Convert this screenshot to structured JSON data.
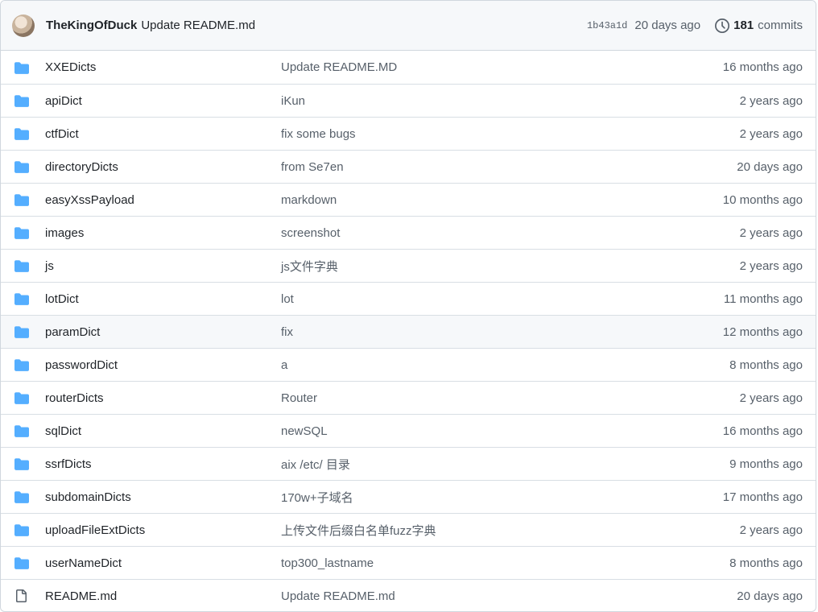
{
  "latest_commit": {
    "author": "TheKingOfDuck",
    "message": "Update README.md",
    "sha": "1b43a1d",
    "age": "20 days ago",
    "commit_count": "181",
    "commits_label": "commits"
  },
  "files": [
    {
      "type": "folder",
      "name": "XXEDicts",
      "message": "Update README.MD",
      "date": "16 months ago"
    },
    {
      "type": "folder",
      "name": "apiDict",
      "message": "iKun",
      "date": "2 years ago"
    },
    {
      "type": "folder",
      "name": "ctfDict",
      "message": "fix some bugs",
      "date": "2 years ago"
    },
    {
      "type": "folder",
      "name": "directoryDicts",
      "message": "from Se7en",
      "date": "20 days ago"
    },
    {
      "type": "folder",
      "name": "easyXssPayload",
      "message": "markdown",
      "date": "10 months ago"
    },
    {
      "type": "folder",
      "name": "images",
      "message": "screenshot",
      "date": "2 years ago"
    },
    {
      "type": "folder",
      "name": "js",
      "message": "js文件字典",
      "date": "2 years ago"
    },
    {
      "type": "folder",
      "name": "lotDict",
      "message": "lot",
      "date": "11 months ago"
    },
    {
      "type": "folder",
      "name": "paramDict",
      "message": "fix",
      "date": "12 months ago"
    },
    {
      "type": "folder",
      "name": "passwordDict",
      "message": "a",
      "date": "8 months ago"
    },
    {
      "type": "folder",
      "name": "routerDicts",
      "message": "Router",
      "date": "2 years ago"
    },
    {
      "type": "folder",
      "name": "sqlDict",
      "message": "newSQL",
      "date": "16 months ago"
    },
    {
      "type": "folder",
      "name": "ssrfDicts",
      "message": "aix /etc/ 目录",
      "date": "9 months ago"
    },
    {
      "type": "folder",
      "name": "subdomainDicts",
      "message": "170w+子域名",
      "date": "17 months ago"
    },
    {
      "type": "folder",
      "name": "uploadFileExtDicts",
      "message": "上传文件后缀白名单fuzz字典",
      "date": "2 years ago"
    },
    {
      "type": "folder",
      "name": "userNameDict",
      "message": "top300_lastname",
      "date": "8 months ago"
    },
    {
      "type": "file",
      "name": "README.md",
      "message": "Update README.md",
      "date": "20 days ago"
    }
  ],
  "colors": {
    "folder_icon": "#54aeff",
    "file_icon": "#57606a",
    "header_bg": "#f6f8fa",
    "border": "#d0d7de",
    "muted_text": "#57606a"
  },
  "icons": {
    "folder": "folder-icon",
    "file": "file-icon",
    "history": "history-icon",
    "avatar": "avatar"
  },
  "highlighted_row": 8
}
